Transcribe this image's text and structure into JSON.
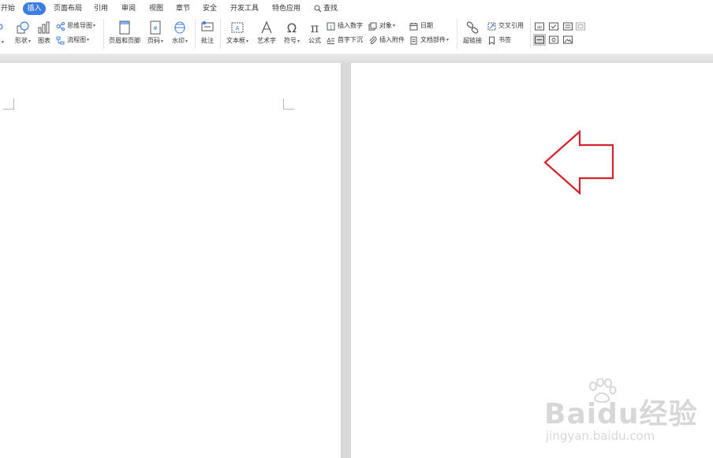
{
  "tabs": [
    {
      "id": "home",
      "label": "开始",
      "active": false
    },
    {
      "id": "insert",
      "label": "插入",
      "active": true
    },
    {
      "id": "layout",
      "label": "页面布局",
      "active": false
    },
    {
      "id": "references",
      "label": "引用",
      "active": false
    },
    {
      "id": "review",
      "label": "审阅",
      "active": false
    },
    {
      "id": "view",
      "label": "视图",
      "active": false
    },
    {
      "id": "section",
      "label": "章节",
      "active": false
    },
    {
      "id": "security",
      "label": "安全",
      "active": false
    },
    {
      "id": "developer",
      "label": "开发工具",
      "active": false
    },
    {
      "id": "features",
      "label": "特色应用",
      "active": false
    },
    {
      "id": "search",
      "label": "查找",
      "active": false
    }
  ],
  "ribbon": {
    "shapes": "形状",
    "chart": "图表",
    "mindmap": "思维导图",
    "flowchart": "流程图",
    "header_footer": "页眉和页脚",
    "page_number": "页码",
    "watermark": "水印",
    "comment": "批注",
    "textbox": "文本框",
    "wordart": "艺术字",
    "symbol": "符号",
    "formula": "公式",
    "insert_number": "插入数字",
    "drop_cap": "首字下沉",
    "object": "对象",
    "attachment": "插入附件",
    "date": "日期",
    "doc_parts": "文档部件",
    "hyperlink": "超链接",
    "cross_ref": "交叉引用",
    "bookmark": "书签"
  },
  "watermark": {
    "brand": "Baidu经验",
    "url": "jingyan.baidu.com"
  },
  "colors": {
    "accent": "#3b7de8",
    "callout_arrow": "#d9222a",
    "workspace": "#d9d9d9"
  }
}
